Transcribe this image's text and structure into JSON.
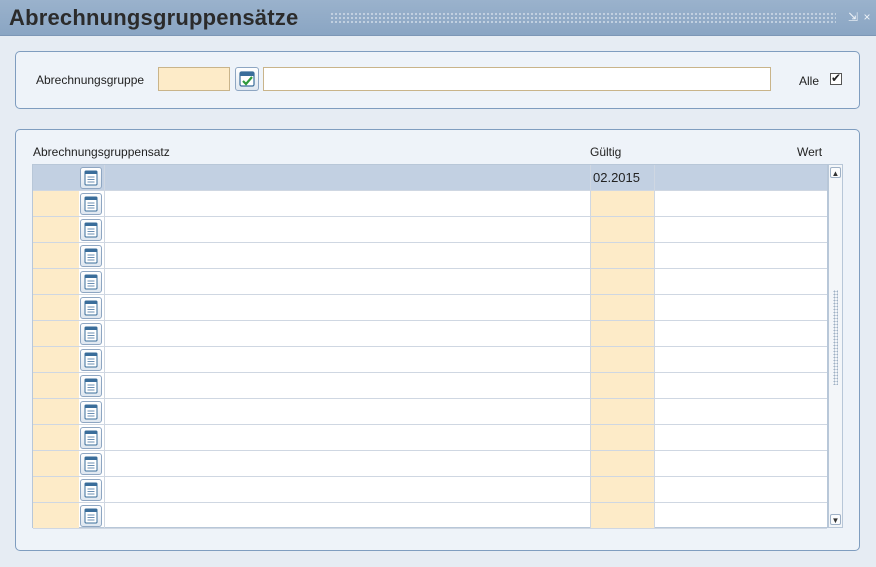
{
  "window": {
    "title": "Abrechnungsgruppensätze",
    "controls": [
      "minimize-icon",
      "close-icon"
    ],
    "minimize_glyph": "⇲",
    "close_glyph": "×"
  },
  "filter": {
    "group_label": "Abrechnungsgruppe",
    "group_code_value": "",
    "group_name_value": "",
    "all_label": "Alle",
    "all_checked": true,
    "check_glyph": "✔"
  },
  "table": {
    "headers": {
      "name": "Abrechnungsgruppensatz",
      "valid": "Gültig",
      "value": "Wert"
    },
    "rows": [
      {
        "name": "",
        "valid": "02.2015",
        "value": "",
        "selected": true
      },
      {
        "name": "",
        "valid": "",
        "value": ""
      },
      {
        "name": "",
        "valid": "",
        "value": ""
      },
      {
        "name": "",
        "valid": "",
        "value": ""
      },
      {
        "name": "",
        "valid": "",
        "value": ""
      },
      {
        "name": "",
        "valid": "",
        "value": ""
      },
      {
        "name": "",
        "valid": "",
        "value": ""
      },
      {
        "name": "",
        "valid": "",
        "value": ""
      },
      {
        "name": "",
        "valid": "",
        "value": ""
      },
      {
        "name": "",
        "valid": "",
        "value": ""
      },
      {
        "name": "",
        "valid": "",
        "value": ""
      },
      {
        "name": "",
        "valid": "",
        "value": ""
      },
      {
        "name": "",
        "valid": "",
        "value": ""
      },
      {
        "name": "",
        "valid": "",
        "value": ""
      }
    ]
  },
  "scrollbar": {
    "up_glyph": "▲",
    "down_glyph": "▼"
  },
  "colors": {
    "titlebar": "#8aa5c3",
    "required_field": "#fdebc8",
    "selected_row": "#c2d0e2",
    "panel_border": "#7f9dbf"
  }
}
